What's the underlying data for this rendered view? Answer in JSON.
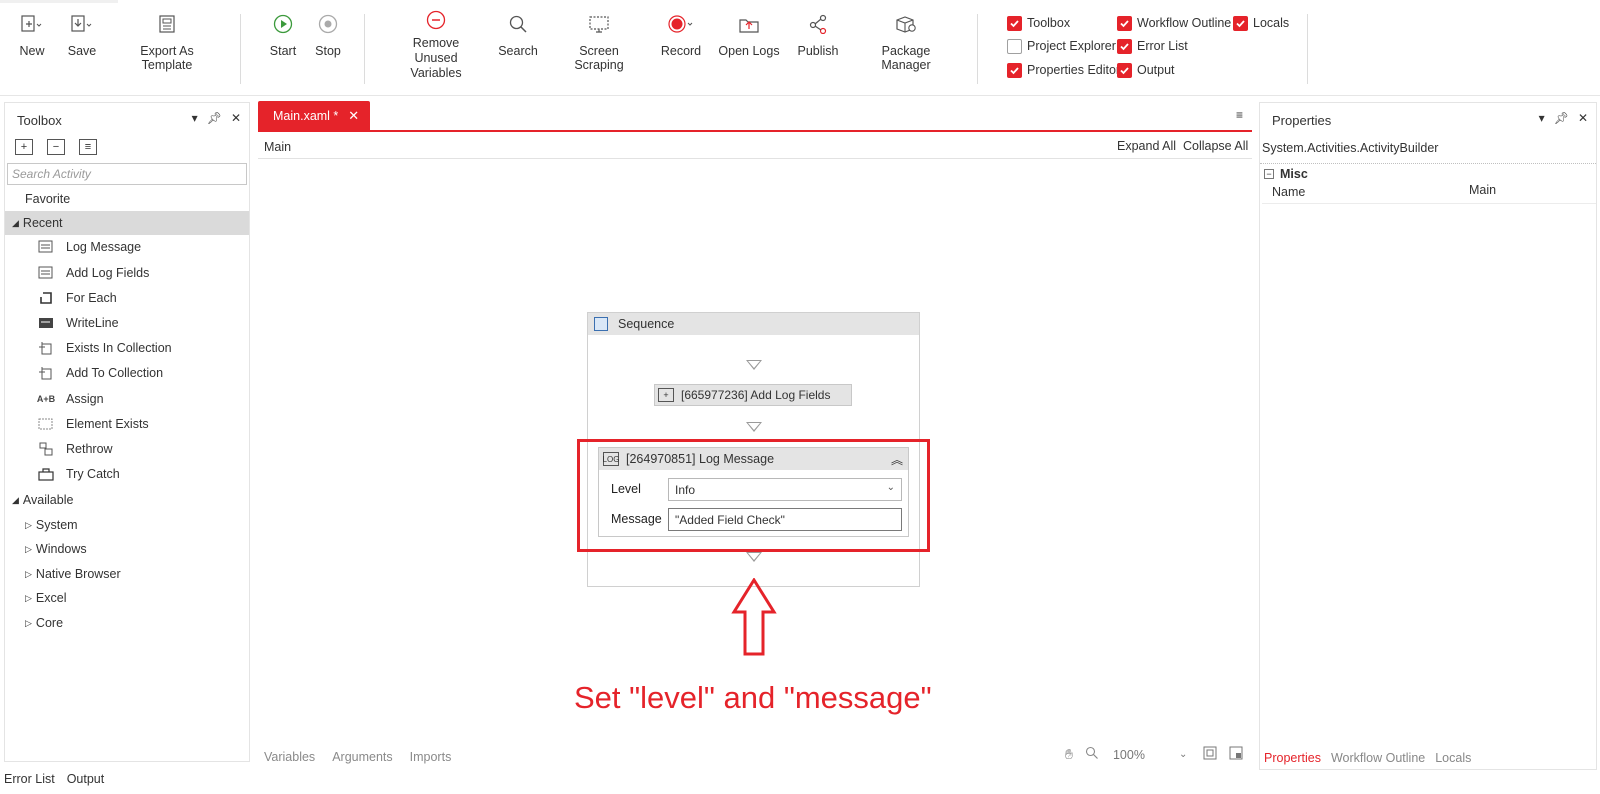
{
  "ribbon": {
    "buttons": {
      "new": "New",
      "save": "Save",
      "export_template": "Export As Template",
      "start": "Start",
      "stop": "Stop",
      "remove_unused_line1": "Remove Unused",
      "remove_unused_line2": "Variables",
      "search": "Search",
      "screen_scraping": "Screen Scraping",
      "record": "Record",
      "open_logs": "Open Logs",
      "publish": "Publish",
      "package_manager": "Package Manager"
    },
    "panels": {
      "toolbox": "Toolbox",
      "workflow_outline": "Workflow Outline",
      "locals": "Locals",
      "project_explorer": "Project Explorer",
      "error_list": "Error List",
      "properties_editor": "Properties Editor",
      "output": "Output"
    }
  },
  "toolbox": {
    "title": "Toolbox",
    "search_placeholder": "Search Activity",
    "favorite": "Favorite",
    "recent": "Recent",
    "recent_items": [
      "Log Message",
      "Add Log Fields",
      "For Each",
      "WriteLine",
      "Exists In Collection",
      "Add To Collection",
      "Assign",
      "Element Exists",
      "Rethrow",
      "Try Catch"
    ],
    "available": "Available",
    "available_groups": [
      "System",
      "Windows",
      "Native Browser",
      "Excel",
      "Core"
    ]
  },
  "designer": {
    "tab": "Main.xaml *",
    "breadcrumb": "Main",
    "expand_all": "Expand All",
    "collapse_all": "Collapse All",
    "sequence_title": "Sequence",
    "add_log_fields_title": "[665977236] Add Log Fields",
    "log_message_title": "[264970851] Log Message",
    "level_label": "Level",
    "level_value": "Info",
    "message_label": "Message",
    "message_value": "\"Added Field Check\"",
    "annotation": "Set \"level\" and \"message\"",
    "bottom_tabs": [
      "Variables",
      "Arguments",
      "Imports"
    ],
    "zoom": "100%"
  },
  "properties": {
    "title": "Properties",
    "type": "System.Activities.ActivityBuilder",
    "category": "Misc",
    "name_label": "Name",
    "name_value": "Main",
    "tabs": [
      "Properties",
      "Workflow Outline",
      "Locals"
    ]
  },
  "status_tabs": [
    "Error List",
    "Output"
  ],
  "colors": {
    "accent": "#e5232a",
    "start_green": "#3c9a3c"
  }
}
